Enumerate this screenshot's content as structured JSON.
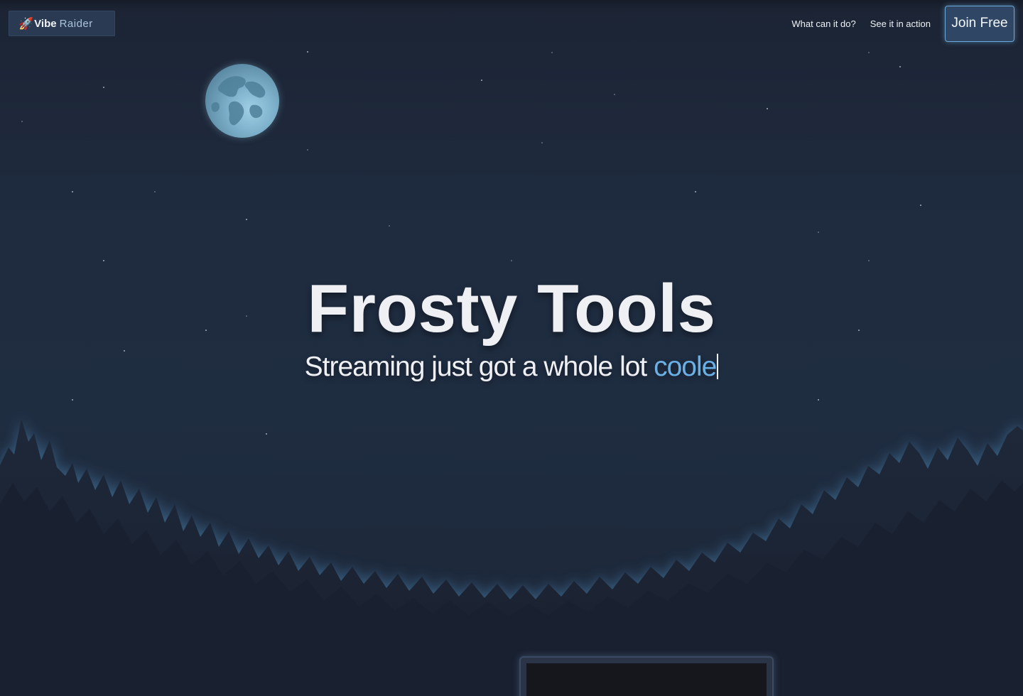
{
  "header": {
    "logo": {
      "icon": "rocket-icon",
      "glyph": "🚀",
      "brand_primary": "Vibe",
      "brand_secondary": "Raider"
    },
    "nav": {
      "items": [
        {
          "label": "What can it do?"
        },
        {
          "label": "See it in action"
        }
      ],
      "cta_label": "Join Free"
    }
  },
  "hero": {
    "title": "Frosty Tools",
    "subtitle_prefix": "Streaming just got a whole lot ",
    "subtitle_typed": "coole"
  },
  "colors": {
    "background": "#1f2c40",
    "accent": "#6ab0e4",
    "cta_border": "#6aa9d8",
    "text": "#eef0f3",
    "moon": "#7eb1cb",
    "forest": "#1a2232"
  }
}
